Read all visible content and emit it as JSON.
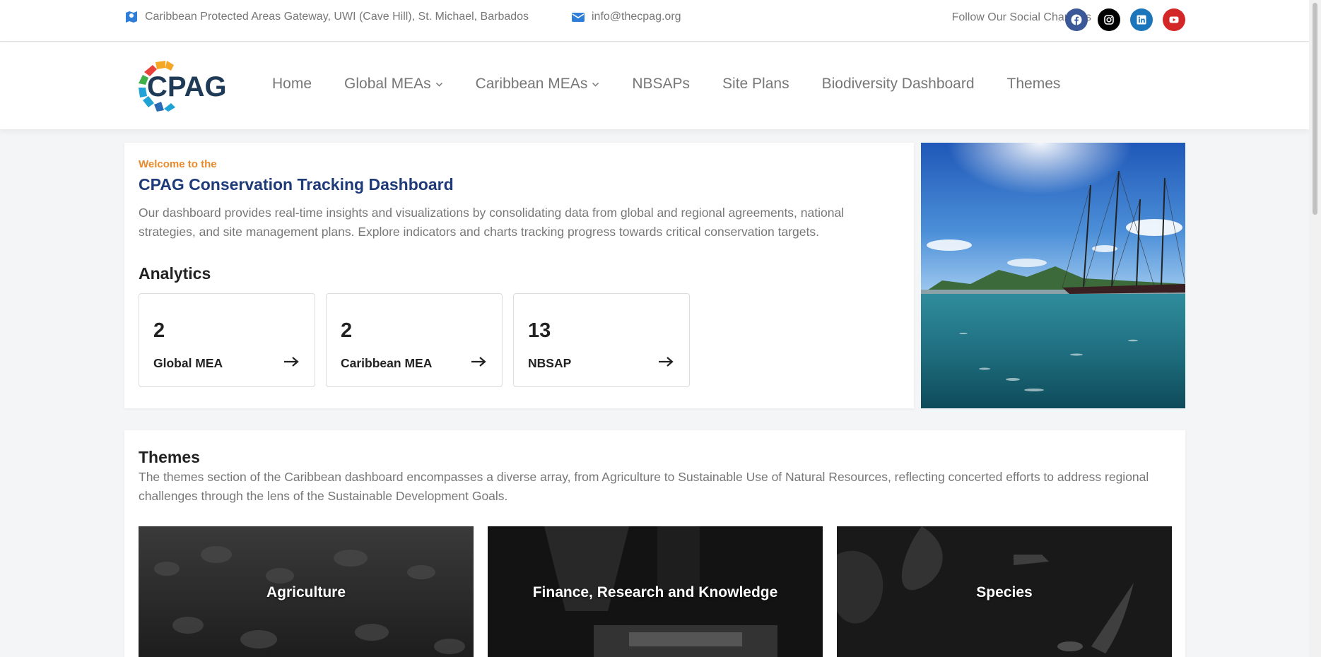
{
  "topbar": {
    "address": "Caribbean Protected Areas Gateway, UWI (Cave Hill), St. Michael, Barbados",
    "email": "info@thecpag.org",
    "follow_label": "Follow Our Social Channels",
    "socials": [
      "facebook-icon",
      "instagram-icon",
      "linkedin-icon",
      "youtube-icon"
    ]
  },
  "logo": {
    "text": "CPAG"
  },
  "nav": {
    "items": [
      {
        "label": "Home",
        "dropdown": false
      },
      {
        "label": "Global MEAs",
        "dropdown": true
      },
      {
        "label": "Caribbean MEAs",
        "dropdown": true
      },
      {
        "label": "NBSAPs",
        "dropdown": false
      },
      {
        "label": "Site Plans",
        "dropdown": false
      },
      {
        "label": "Biodiversity Dashboard",
        "dropdown": false
      },
      {
        "label": "Themes",
        "dropdown": false
      }
    ]
  },
  "welcome": {
    "eyebrow": "Welcome to the",
    "title": "CPAG Conservation Tracking Dashboard",
    "description": "Our dashboard provides real-time insights and visualizations by consolidating data from global and regional agreements, national strategies, and site management plans. Explore indicators and charts tracking progress towards critical conservation targets."
  },
  "analytics": {
    "title": "Analytics",
    "cards": [
      {
        "value": "2",
        "label": "Global MEA"
      },
      {
        "value": "2",
        "label": "Caribbean MEA"
      },
      {
        "value": "13",
        "label": "NBSAP"
      }
    ]
  },
  "themes": {
    "title": "Themes",
    "description": "The themes section of the Caribbean dashboard encompasses a diverse array, from Agriculture to Sustainable Use of Natural Resources, reflecting concerted efforts to address regional challenges through the lens of the Sustainable Development Goals.",
    "tiles": [
      {
        "label": "Agriculture"
      },
      {
        "label": "Finance, Research and Knowledge"
      },
      {
        "label": "Species"
      }
    ]
  },
  "colors": {
    "brand_navy": "#1e3a78",
    "accent_orange": "#e98a2b",
    "facebook": "#3b5998",
    "linkedin": "#1b75bb",
    "youtube": "#d32626"
  }
}
